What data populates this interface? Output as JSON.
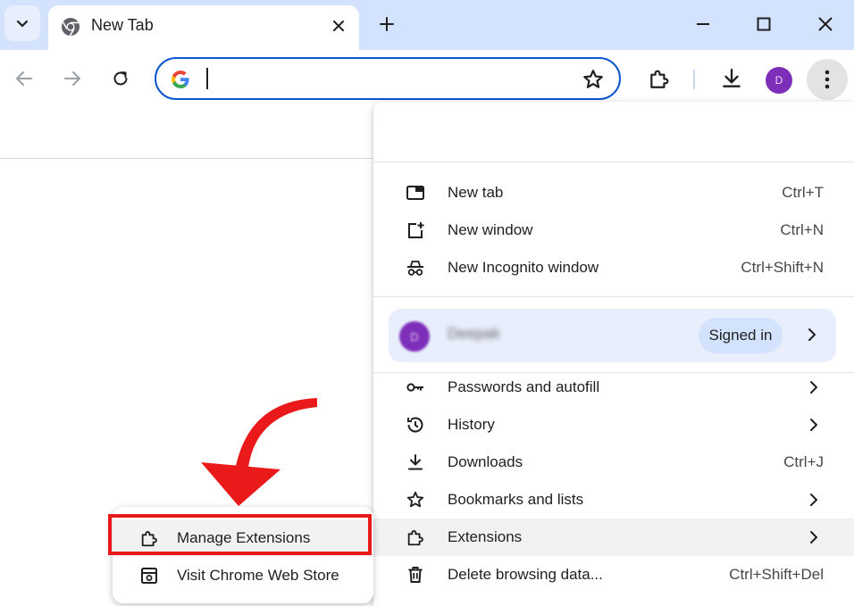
{
  "browser": {
    "tab": {
      "title": "New Tab"
    },
    "omnibox": {
      "value": "",
      "placeholder": ""
    },
    "profile_initial": "D"
  },
  "menu": {
    "items_top": [
      {
        "label": "New tab",
        "shortcut": "Ctrl+T",
        "icon": "new-tab-icon"
      },
      {
        "label": "New window",
        "shortcut": "Ctrl+N",
        "icon": "new-window-icon"
      },
      {
        "label": "New Incognito window",
        "shortcut": "Ctrl+Shift+N",
        "icon": "incognito-icon"
      }
    ],
    "profile": {
      "initial": "D",
      "name": "Deepak",
      "status": "Signed in"
    },
    "items_bottom": [
      {
        "label": "Passwords and autofill",
        "shortcut": "",
        "icon": "key-icon"
      },
      {
        "label": "History",
        "shortcut": "",
        "icon": "history-icon"
      },
      {
        "label": "Downloads",
        "shortcut": "Ctrl+J",
        "icon": "download-icon"
      },
      {
        "label": "Bookmarks and lists",
        "shortcut": "",
        "icon": "star-icon"
      },
      {
        "label": "Extensions",
        "shortcut": "",
        "icon": "puzzle-icon"
      },
      {
        "label": "Delete browsing data...",
        "shortcut": "Ctrl+Shift+Del",
        "icon": "trash-icon"
      }
    ]
  },
  "extensions_submenu": {
    "manage": "Manage Extensions",
    "store": "Visit Chrome Web Store"
  },
  "colors": {
    "tabstrip": "#d3e3fd",
    "accent": "#0b57d0",
    "annotation": "#ea1a1a",
    "avatar": "#7e2fba"
  }
}
